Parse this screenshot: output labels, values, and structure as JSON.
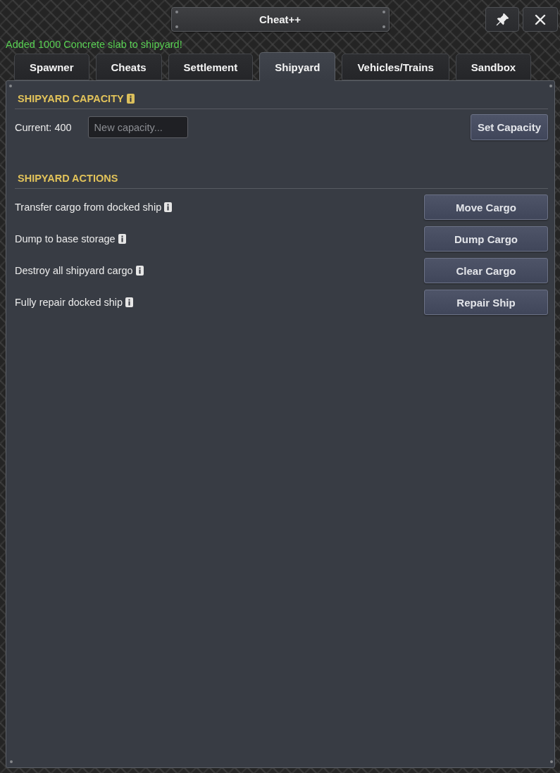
{
  "window": {
    "title": "Cheat++"
  },
  "status_message": "Added 1000 Concrete slab to shipyard!",
  "tabs": [
    {
      "label": "Spawner",
      "selected": false
    },
    {
      "label": "Cheats",
      "selected": false
    },
    {
      "label": "Settlement",
      "selected": false
    },
    {
      "label": "Shipyard",
      "selected": true
    },
    {
      "label": "Vehicles/Trains",
      "selected": false
    },
    {
      "label": "Sandbox",
      "selected": false
    }
  ],
  "sections": [
    {
      "kind": "capacity",
      "title": "SHIPYARD CAPACITY",
      "info": true,
      "current": "Current: 400",
      "input": {
        "placeholder": "New capacity..."
      },
      "button": "Set Capacity"
    },
    {
      "kind": "actions",
      "title": "SHIPYARD ACTIONS",
      "info": false,
      "actions": [
        {
          "label": "Transfer cargo from docked ship",
          "info": true,
          "button": "Move Cargo"
        },
        {
          "label": "Dump to base storage",
          "info": true,
          "button": "Dump Cargo"
        },
        {
          "label": "Destroy all shipyard cargo",
          "info": true,
          "button": "Clear Cargo"
        },
        {
          "label": "Fully repair docked ship",
          "info": true,
          "button": "Repair Ship"
        }
      ]
    }
  ]
}
